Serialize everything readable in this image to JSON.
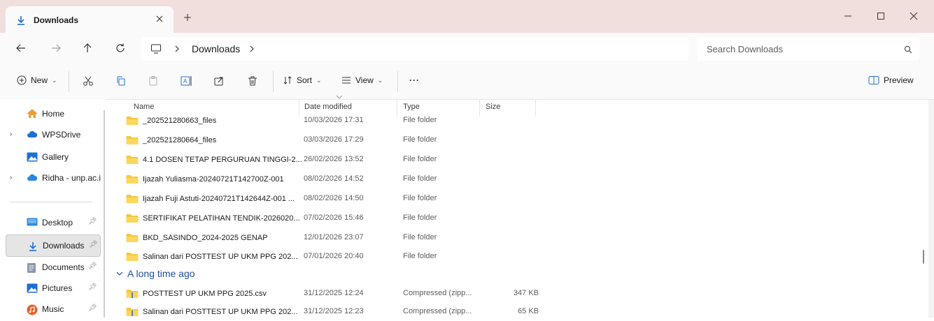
{
  "titlebar": {
    "tab_title": "Downloads",
    "colors": {
      "background": "#f1dfdd",
      "tab": "#fafafa"
    }
  },
  "address": {
    "location": "Downloads"
  },
  "search": {
    "placeholder": "Search Downloads"
  },
  "commands": {
    "new_label": "New",
    "sort_label": "Sort",
    "view_label": "View",
    "more_label": "···",
    "preview_label": "Preview"
  },
  "nav": {
    "items": [
      {
        "label": "Home",
        "icon": "home-icon"
      },
      {
        "label": "WPSDrive",
        "icon": "cloud-icon"
      },
      {
        "label": "Gallery",
        "icon": "gallery-icon"
      },
      {
        "label": "Ridha - unp.ac.i",
        "icon": "onedrive-icon"
      },
      {
        "label": "Desktop",
        "icon": "desktop-icon"
      },
      {
        "label": "Downloads",
        "icon": "download-icon"
      },
      {
        "label": "Documents",
        "icon": "documents-icon"
      },
      {
        "label": "Pictures",
        "icon": "pictures-icon"
      },
      {
        "label": "Music",
        "icon": "music-icon"
      }
    ],
    "selected": "Downloads"
  },
  "columns": {
    "name": "Name",
    "date": "Date modified",
    "type": "Type",
    "size": "Size"
  },
  "rows": [
    {
      "name": "_202521280663_files",
      "date": "10/03/2026 17:31",
      "type": "File folder",
      "size": ""
    },
    {
      "name": "_202521280664_files",
      "date": "03/03/2026 17:29",
      "type": "File folder",
      "size": ""
    },
    {
      "name": "4.1 DOSEN TETAP PERGURUAN TINGGI-2...",
      "date": "26/02/2026 13:52",
      "type": "File folder",
      "size": ""
    },
    {
      "name": "Ijazah Yuliasma-20240721T142700Z-001",
      "date": "08/02/2026 14:52",
      "type": "File folder",
      "size": ""
    },
    {
      "name": "Ijazah Fuji Astuti-20240721T142644Z-001 ...",
      "date": "08/02/2026 14:50",
      "type": "File folder",
      "size": ""
    },
    {
      "name": "SERTIFIKAT PELATIHAN TENDIK-2026020...",
      "date": "07/02/2026 15:46",
      "type": "File folder",
      "size": ""
    },
    {
      "name": "BKD_SASINDO_2024-2025 GENAP",
      "date": "12/01/2026 23:07",
      "type": "File folder",
      "size": ""
    },
    {
      "name": "Salinan dari POSTTEST UP UKM PPG 202...",
      "date": "07/01/2026 20:40",
      "type": "File folder",
      "size": ""
    }
  ],
  "group": {
    "label": "A long time ago"
  },
  "group_rows": [
    {
      "name": "POSTTEST UP UKM PPG 2025.csv",
      "date": "31/12/2025 12:24",
      "type": "Compressed (zipp...",
      "size": "347 KB"
    },
    {
      "name": "Salinan dari POSTTEST UP UKM PPG 202...",
      "date": "31/12/2025 12:23",
      "type": "Compressed (zipp...",
      "size": "65 KB"
    }
  ],
  "colors": {
    "folder": "#f5c842",
    "accent": "#1f6fd1",
    "group_header": "#1f4e9e"
  }
}
